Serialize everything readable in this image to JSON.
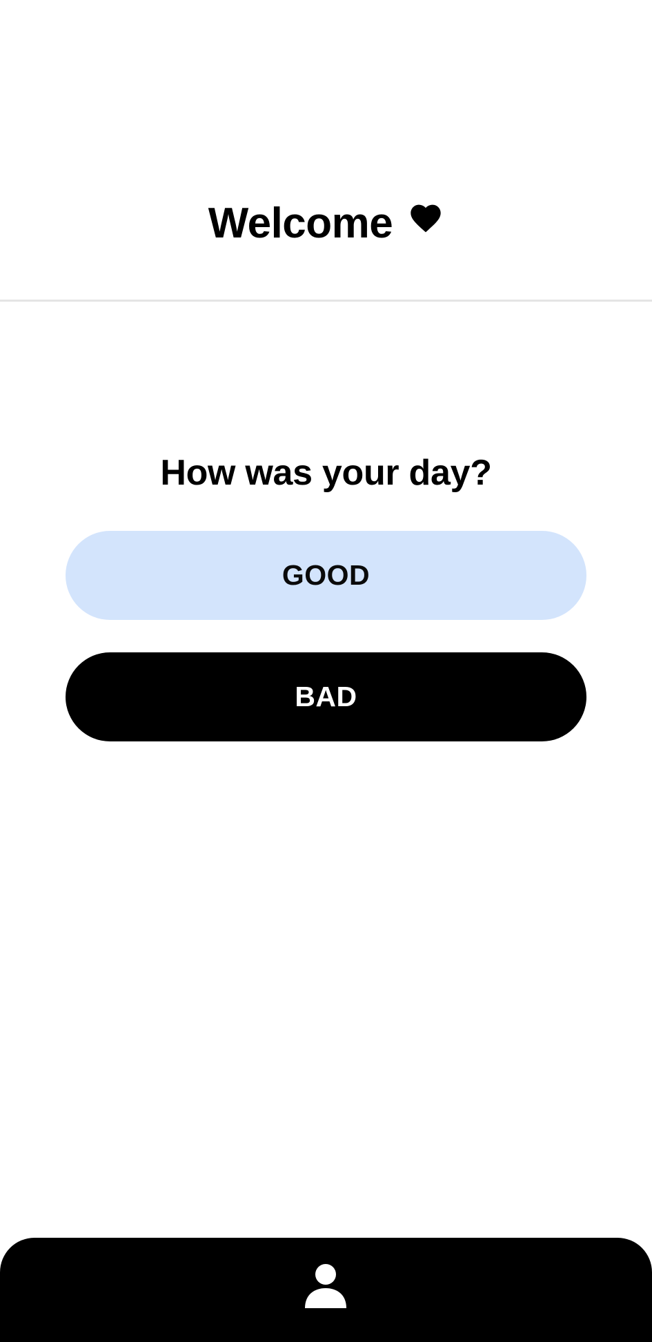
{
  "header": {
    "title": "Welcome",
    "title_icon": "heart-icon"
  },
  "main": {
    "question": "How was your day?",
    "good_label": "GOOD",
    "bad_label": "BAD"
  },
  "bottom_nav": {
    "profile_icon": "person-icon"
  },
  "colors": {
    "good_button_bg": "#d3e4fc",
    "bad_button_bg": "#000000",
    "nav_bg": "#000000",
    "divider": "#e4e4e4"
  }
}
